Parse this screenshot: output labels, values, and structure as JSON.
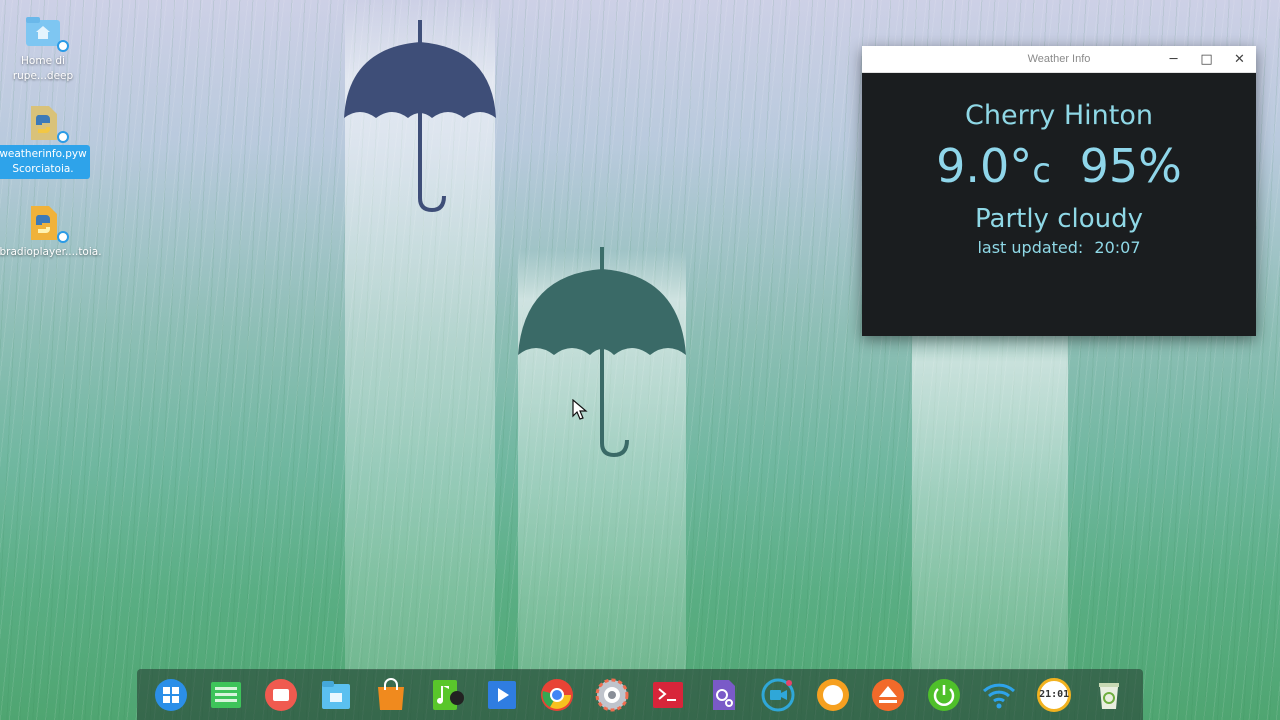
{
  "desktop": {
    "icons": [
      {
        "label": "Home di rupe...deep",
        "icon": "folder-home-icon",
        "selected": false
      },
      {
        "label": "weatherinfo.pyw Scorciatoia.",
        "icon": "python-file-icon",
        "selected": true
      },
      {
        "label": "webradioplayer....toia.",
        "icon": "python-file-icon",
        "selected": false
      }
    ]
  },
  "window": {
    "title": "Weather Info",
    "controls": {
      "minimize": "─",
      "maximize": "□",
      "close": "✕"
    },
    "city": "Cherry Hinton",
    "temperature": "9.0°",
    "temperature_unit": "c",
    "humidity": "95%",
    "condition": "Partly cloudy",
    "last_updated_label": "last updated:",
    "last_updated_time": "20:07",
    "text_color": "#8fd6ea",
    "background": "#1a1d1f"
  },
  "dock": {
    "items": [
      {
        "name": "launcher",
        "icon": "launcher-grid-icon",
        "color": "#2b8fe8"
      },
      {
        "name": "multitask-view",
        "icon": "multitask-icon",
        "color": "#3ec45a"
      },
      {
        "name": "screen-recorder",
        "icon": "record-icon",
        "color": "#f05a4f"
      },
      {
        "name": "file-manager",
        "icon": "file-manager-icon",
        "color": "#5bc0f0"
      },
      {
        "name": "app-store",
        "icon": "shopping-bag-icon",
        "color": "#f08a1e"
      },
      {
        "name": "music",
        "icon": "music-note-icon",
        "color": "#59c62b"
      },
      {
        "name": "movie",
        "icon": "movie-play-icon",
        "color": "#2f7de1"
      },
      {
        "name": "chrome",
        "icon": "chrome-icon",
        "color": "#e84335"
      },
      {
        "name": "control-center",
        "icon": "settings-gear-icon",
        "color": "#c0c4cc"
      },
      {
        "name": "terminal",
        "icon": "terminal-icon",
        "color": "#d8253a"
      },
      {
        "name": "system-settings",
        "icon": "system-settings-icon",
        "color": "#7a5ac8"
      },
      {
        "name": "camera",
        "icon": "camera-icon",
        "color": "#2fa7d8"
      },
      {
        "name": "clock-app",
        "icon": "clock-circle-icon",
        "color": "#f6a020"
      },
      {
        "name": "eject",
        "icon": "eject-icon",
        "color": "#f26a2a"
      },
      {
        "name": "power",
        "icon": "power-icon",
        "color": "#4fc02a"
      },
      {
        "name": "network",
        "icon": "wifi-icon",
        "color": "#2ea3ea"
      },
      {
        "name": "time",
        "icon": "clock-digital-icon",
        "color": "#f2b21f"
      },
      {
        "name": "trash",
        "icon": "trash-icon",
        "color": "#a9cc78"
      }
    ],
    "time_text": "21:01"
  }
}
